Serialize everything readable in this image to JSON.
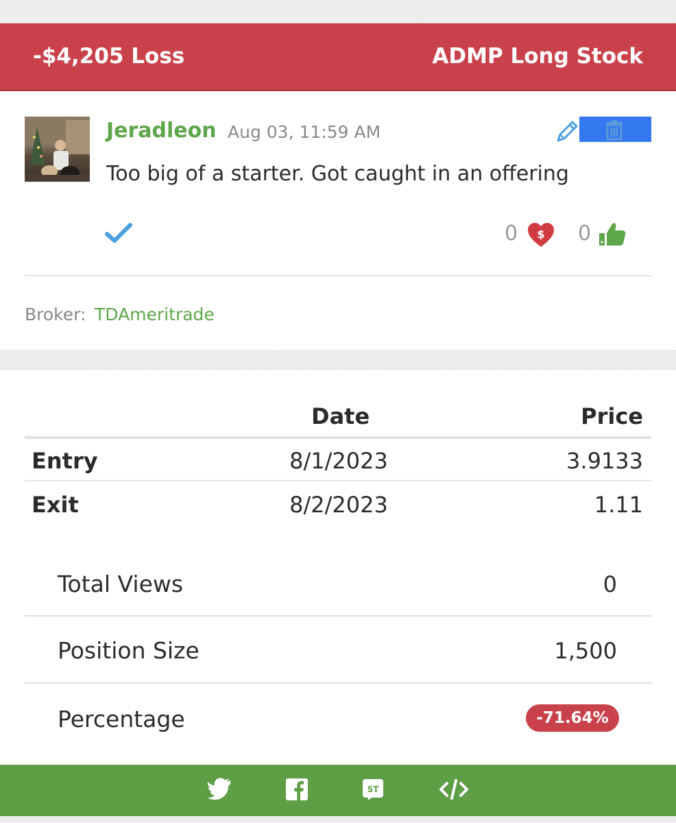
{
  "trade": {
    "result_label": "-$4,205 Loss",
    "symbol_label": "ADMP Long Stock"
  },
  "post": {
    "username": "Jeradleon",
    "timestamp": "Aug 03, 11:59 AM",
    "comment": "Too big of a starter. Got caught in an offering",
    "tips_count": "0",
    "likes_count": "0",
    "broker_label": "Broker:",
    "broker_name": "TDAmeritrade"
  },
  "table": {
    "headers": [
      "",
      "Date",
      "Price"
    ],
    "rows": [
      {
        "label": "Entry",
        "date": "8/1/2023",
        "price": "3.9133"
      },
      {
        "label": "Exit",
        "date": "8/2/2023",
        "price": "1.11"
      }
    ]
  },
  "stats": [
    {
      "label": "Total Views",
      "value": "0"
    },
    {
      "label": "Position Size",
      "value": "1,500"
    },
    {
      "label": "Percentage",
      "value": "-71.64%"
    }
  ],
  "colors": {
    "loss_red": "#c9424b",
    "accent_green": "#5ea64a",
    "footer_green": "#5e9e45",
    "action_blue": "#3478f0",
    "check_blue": "#4a9fe0"
  },
  "icons": {
    "edit": "pencil-icon",
    "delete": "trash-icon",
    "verified": "check-icon",
    "tip": "heart-dollar-icon",
    "like": "thumbs-up-icon",
    "share": [
      "twitter-icon",
      "facebook-icon",
      "stocktwits-icon",
      "embed-code-icon"
    ]
  }
}
